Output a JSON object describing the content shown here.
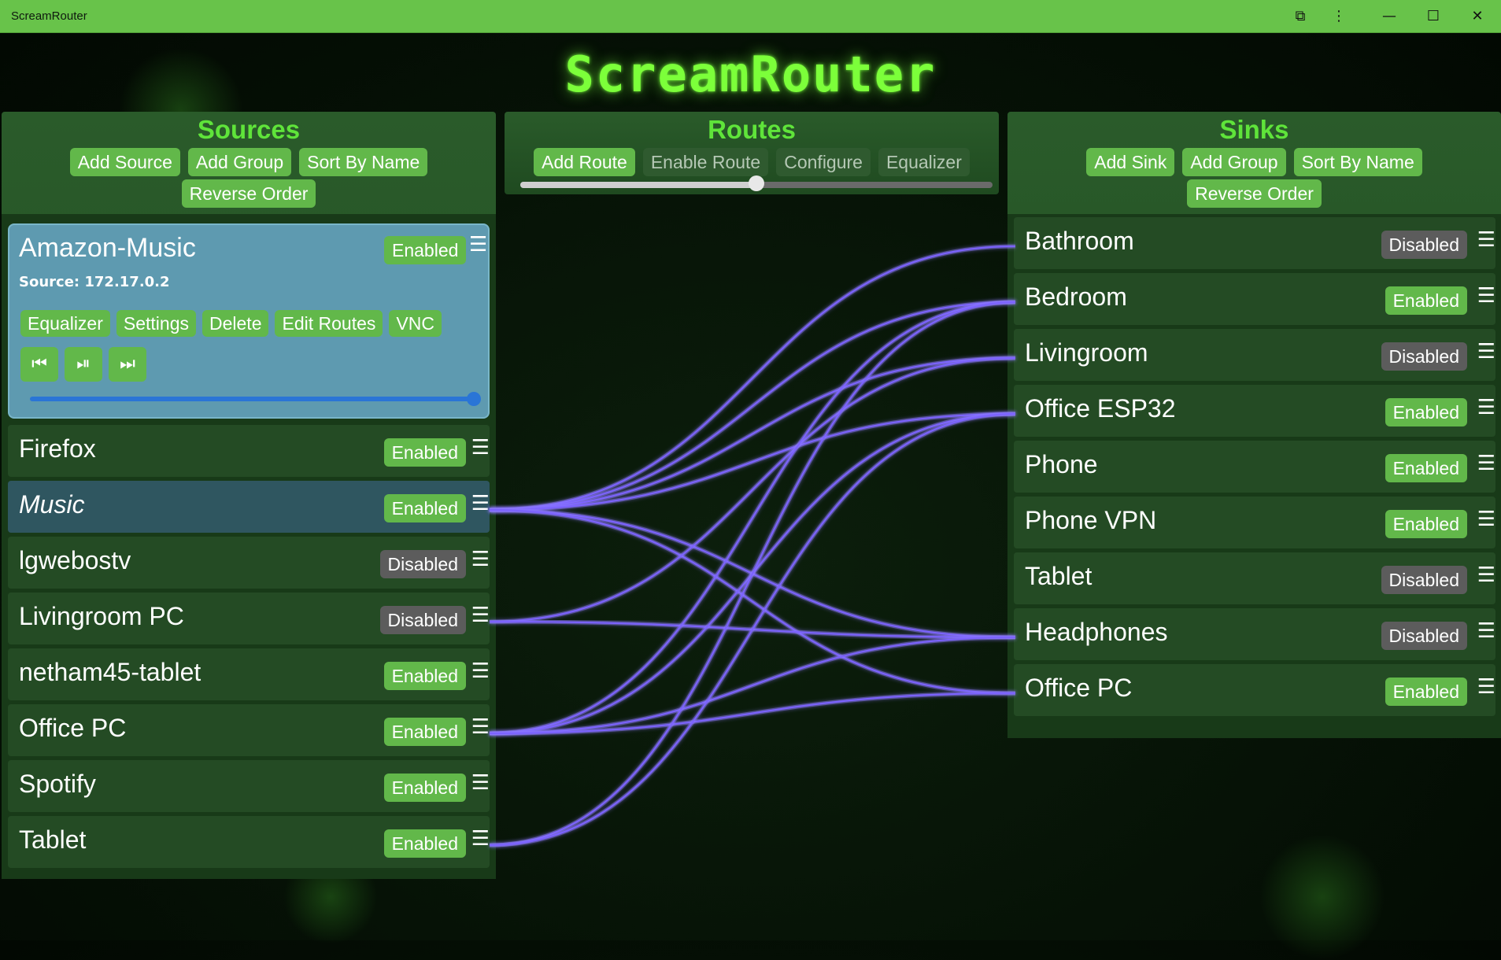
{
  "window": {
    "title": "ScreamRouter",
    "controls": [
      {
        "name": "extensions-icon",
        "glyph": "⧉"
      },
      {
        "name": "more-options-icon",
        "glyph": "⋮"
      },
      {
        "name": "minimize-icon",
        "glyph": "—"
      },
      {
        "name": "maximize-icon",
        "glyph": "☐"
      },
      {
        "name": "close-icon",
        "glyph": "✕"
      }
    ]
  },
  "app_title": "ScreamRouter",
  "sources_panel": {
    "title": "Sources",
    "buttons": {
      "add_source": "Add Source",
      "add_group": "Add Group",
      "sort_by_name": "Sort By Name",
      "reverse_order": "Reverse Order"
    },
    "selected": {
      "name": "Amazon-Music",
      "status": "Enabled",
      "source_label": "Source: 172.17.0.2",
      "actions": [
        "Equalizer",
        "Settings",
        "Delete",
        "Edit Routes",
        "VNC"
      ],
      "media": [
        {
          "name": "previous-track-icon",
          "glyph": "⏮"
        },
        {
          "name": "play-pause-icon",
          "glyph": "⏯"
        },
        {
          "name": "next-track-icon",
          "glyph": "⏭"
        }
      ],
      "volume_fraction": 1.0
    },
    "items": [
      {
        "name": "Firefox",
        "status": "Enabled",
        "italic": false
      },
      {
        "name": "Music",
        "status": "Enabled",
        "italic": true
      },
      {
        "name": "lgwebostv",
        "status": "Disabled",
        "italic": false
      },
      {
        "name": "Livingroom PC",
        "status": "Disabled",
        "italic": false
      },
      {
        "name": "netham45-tablet",
        "status": "Enabled",
        "italic": false
      },
      {
        "name": "Office PC",
        "status": "Enabled",
        "italic": false
      },
      {
        "name": "Spotify",
        "status": "Enabled",
        "italic": false
      },
      {
        "name": "Tablet",
        "status": "Enabled",
        "italic": false
      }
    ]
  },
  "routes_panel": {
    "title": "Routes",
    "buttons": {
      "add_route": "Add Route",
      "enable_route": "Enable Route",
      "configure": "Configure",
      "equalizer": "Equalizer"
    },
    "slider_fraction": 0.5
  },
  "sinks_panel": {
    "title": "Sinks",
    "buttons": {
      "add_sink": "Add Sink",
      "add_group": "Add Group",
      "sort_by_name": "Sort By Name",
      "reverse_order": "Reverse Order"
    },
    "items": [
      {
        "name": "Bathroom",
        "status": "Disabled"
      },
      {
        "name": "Bedroom",
        "status": "Enabled"
      },
      {
        "name": "Livingroom",
        "status": "Disabled"
      },
      {
        "name": "Office ESP32",
        "status": "Enabled"
      },
      {
        "name": "Phone",
        "status": "Enabled"
      },
      {
        "name": "Phone VPN",
        "status": "Enabled"
      },
      {
        "name": "Tablet",
        "status": "Disabled"
      },
      {
        "name": "Headphones",
        "status": "Disabled"
      },
      {
        "name": "Office PC",
        "status": "Enabled"
      }
    ]
  },
  "routes": [
    {
      "from": "Music",
      "to": "Bathroom"
    },
    {
      "from": "Music",
      "to": "Bedroom"
    },
    {
      "from": "Music",
      "to": "Livingroom"
    },
    {
      "from": "Music",
      "to": "Office ESP32"
    },
    {
      "from": "Music",
      "to": "Headphones"
    },
    {
      "from": "Music",
      "to": "Office PC"
    },
    {
      "from": "Livingroom PC",
      "to": "Livingroom"
    },
    {
      "from": "Livingroom PC",
      "to": "Headphones"
    },
    {
      "from": "Office PC",
      "to": "Bedroom"
    },
    {
      "from": "Office PC",
      "to": "Office ESP32"
    },
    {
      "from": "Office PC",
      "to": "Headphones"
    },
    {
      "from": "Office PC",
      "to": "Office PC"
    },
    {
      "from": "Tablet",
      "to": "Bedroom"
    },
    {
      "from": "Tablet",
      "to": "Office ESP32"
    }
  ],
  "colors": {
    "accent": "#62b84a",
    "title_green": "#7cff3a",
    "wire": "#7c63ff",
    "disabled": "#5c5c5c",
    "selected": "#5e9ab0"
  }
}
